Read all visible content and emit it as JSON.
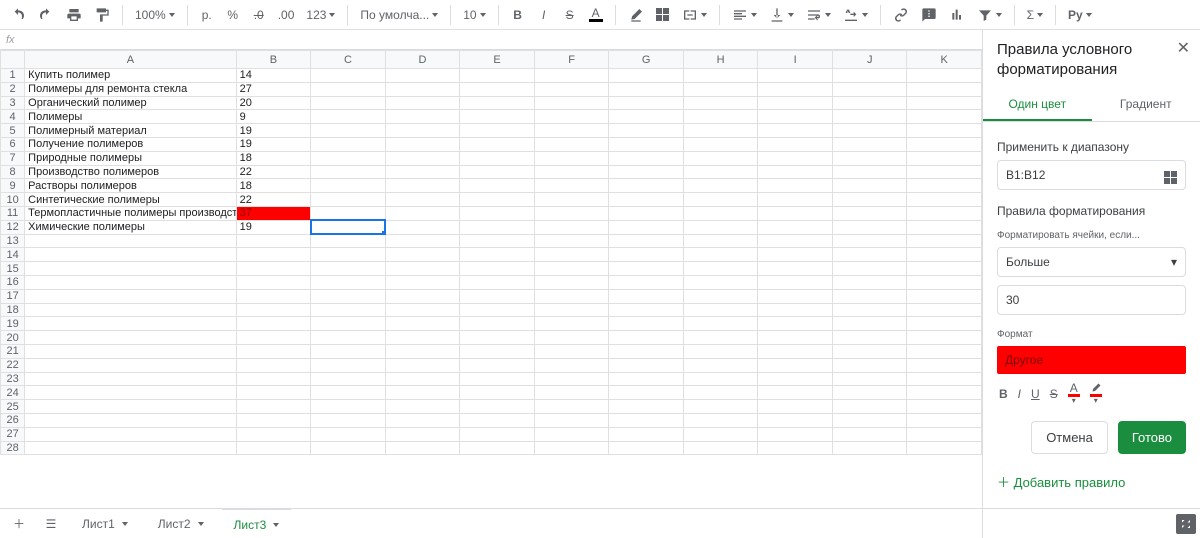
{
  "toolbar": {
    "zoom": "100%",
    "currency": "р.",
    "percent": "%",
    "dec_dec": ".0",
    "dec_inc": ".00",
    "more_fmt": "123",
    "font": "По умолча...",
    "font_size": "10",
    "py_label": "Pу"
  },
  "fx_label": "fx",
  "columns": [
    "A",
    "B",
    "C",
    "D",
    "E",
    "F",
    "G",
    "H",
    "I",
    "J",
    "K"
  ],
  "rows": [
    {
      "n": 1,
      "a": "Купить полимер",
      "b": "14"
    },
    {
      "n": 2,
      "a": "Полимеры для ремонта стекла",
      "b": "27"
    },
    {
      "n": 3,
      "a": "Органический полимер",
      "b": "20"
    },
    {
      "n": 4,
      "a": "Полимеры",
      "b": "9"
    },
    {
      "n": 5,
      "a": "Полимерный материал",
      "b": "19"
    },
    {
      "n": 6,
      "a": "Получение полимеров",
      "b": "19"
    },
    {
      "n": 7,
      "a": "Природные полимеры",
      "b": "18"
    },
    {
      "n": 8,
      "a": "Производство полимеров",
      "b": "22"
    },
    {
      "n": 9,
      "a": "Растворы полимеров",
      "b": "18"
    },
    {
      "n": 10,
      "a": "Синтетические полимеры",
      "b": "22"
    },
    {
      "n": 11,
      "a": "Термопластичные полимеры производство",
      "b": "37",
      "hl": true
    },
    {
      "n": 12,
      "a": "Химические полимеры",
      "b": "19"
    }
  ],
  "empty_rows_from": 13,
  "empty_rows_to": 28,
  "active_cell": "C12",
  "panel": {
    "title": "Правила условного форматирования",
    "tab_single": "Один цвет",
    "tab_gradient": "Градиент",
    "apply_range_label": "Применить к диапазону",
    "range_value": "B1:B12",
    "rules_label": "Правила форматирования",
    "format_if_label": "Форматировать ячейки, если...",
    "condition": "Больше",
    "value": "30",
    "format_label": "Формат",
    "preview_text": "Другое",
    "cancel": "Отмена",
    "done": "Готово",
    "add_rule": "Добавить правило"
  },
  "sheets": {
    "s1": "Лист1",
    "s2": "Лист2",
    "s3": "Лист3"
  }
}
